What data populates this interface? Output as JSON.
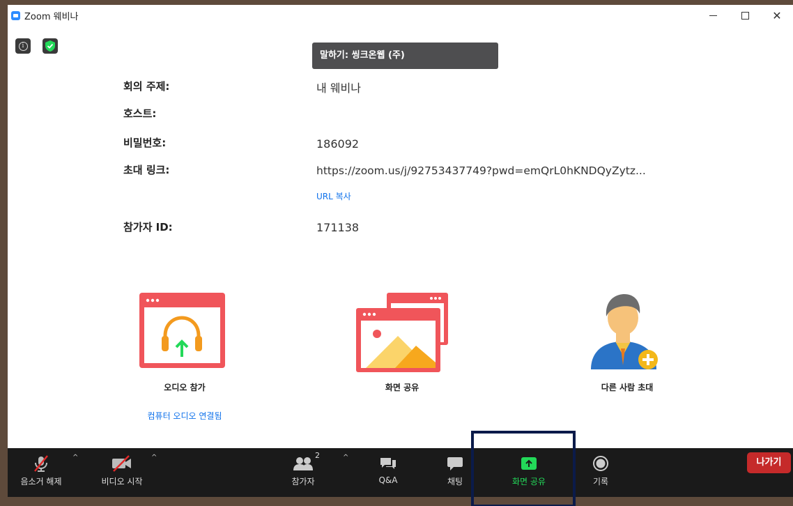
{
  "window": {
    "title": "Zoom 웨비나",
    "minimize": "−",
    "maximize": "□",
    "close": "✕"
  },
  "top_icons": {
    "info": "info-icon",
    "encryption": "shield-check-icon"
  },
  "speaking_indicator": "말하기: 씽크온웹 (주)",
  "meeting_info": {
    "topic_label": "회의 주제:",
    "topic_value": "내 웨비나",
    "host_label": "호스트:",
    "host_value": "",
    "password_label": "비밀번호:",
    "password_value": "186092",
    "invite_label": "초대 링크:",
    "invite_value": "https://zoom.us/j/92753437749?pwd=emQrL0hKNDQyZytz...",
    "copy_url": "URL 복사",
    "participant_id_label": "참가자 ID:",
    "participant_id_value": "171138"
  },
  "actions": {
    "join_audio": {
      "label": "오디오 참가",
      "sub": "컴퓨터 오디오 연결됨"
    },
    "share_screen": {
      "label": "화면 공유"
    },
    "invite": {
      "label": "다른 사람 초대"
    }
  },
  "toolbar": {
    "unmute": "음소거 해제",
    "start_video": "비디오 시작",
    "participants": "참가자",
    "participants_count": "2",
    "qa": "Q&A",
    "chat": "채팅",
    "share_screen": "화면 공유",
    "record": "기록",
    "leave": "나가기",
    "caret": "^"
  },
  "colors": {
    "accent_blue": "#0e71eb",
    "share_green": "#23d959",
    "leave_red": "#c52a2a",
    "illustration_red": "#f0555a",
    "highlight_box": "#0b1b4a"
  }
}
